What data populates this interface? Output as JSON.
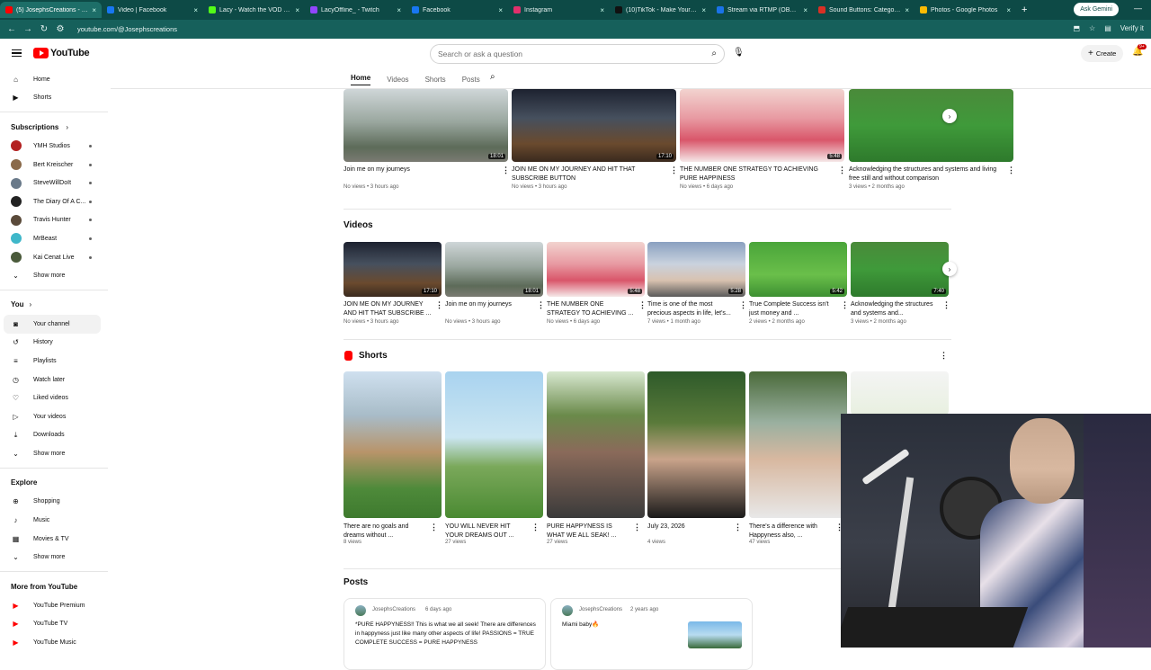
{
  "browser": {
    "tabs": [
      {
        "label": "(5) JosephsCreations - YouTube",
        "color": "#ff0000"
      },
      {
        "label": "Video | Facebook",
        "color": "#1877f2"
      },
      {
        "label": "Lacy - Watch the VOD on Kick",
        "color": "#53fc18"
      },
      {
        "label": "LacyOffline_ - Twitch",
        "color": "#9146ff"
      },
      {
        "label": "Facebook",
        "color": "#1877f2"
      },
      {
        "label": "Instagram",
        "color": "#e1306c"
      },
      {
        "label": "(10)TikTok - Make Your Day",
        "color": "#111111"
      },
      {
        "label": "Stream via RTMP (OBS, Vmix)",
        "color": "#1a73e8"
      },
      {
        "label": "Sound Buttons: Category V",
        "color": "#d93025"
      },
      {
        "label": "Photos - Google Photos",
        "color": "#fbbc04"
      }
    ],
    "ask_gemini": "Ask Gemini",
    "url": "youtube.com/@Josephscreations",
    "verify": "Verify it"
  },
  "header": {
    "logo_text": "YouTube",
    "search_placeholder": "Search or ask a question",
    "create_label": "Create",
    "notif_count": "9+"
  },
  "sidebar": {
    "main": [
      {
        "label": "Home",
        "icon": "home-icon",
        "glyph": "⌂"
      },
      {
        "label": "Shorts",
        "icon": "shorts-icon",
        "glyph": "▶"
      }
    ],
    "subscriptions_title": "Subscriptions",
    "subscriptions": [
      {
        "label": "YMH Studios",
        "color": "#b32020"
      },
      {
        "label": "Bert Kreischer",
        "color": "#8a6a4a"
      },
      {
        "label": "SteveWillDoIt",
        "color": "#6a7a8a"
      },
      {
        "label": "The Diary Of A C...",
        "color": "#222222"
      },
      {
        "label": "Travis Hunter",
        "color": "#5a4a3a"
      },
      {
        "label": "MrBeast",
        "color": "#3fb7c9"
      },
      {
        "label": "Kai Cenat Live",
        "color": "#4a5a3a"
      }
    ],
    "show_more": "Show more",
    "you_title": "You",
    "you_items": [
      {
        "label": "Your channel",
        "glyph": "◙"
      },
      {
        "label": "History",
        "glyph": "↺"
      },
      {
        "label": "Playlists",
        "glyph": "≡"
      },
      {
        "label": "Watch later",
        "glyph": "◷"
      },
      {
        "label": "Liked videos",
        "glyph": "♡"
      },
      {
        "label": "Your videos",
        "glyph": "▷"
      },
      {
        "label": "Downloads",
        "glyph": "⤓"
      }
    ],
    "explore_title": "Explore",
    "explore_items": [
      {
        "label": "Shopping",
        "glyph": "⊕"
      },
      {
        "label": "Music",
        "glyph": "♪"
      },
      {
        "label": "Movies & TV",
        "glyph": "▦"
      }
    ],
    "more_title": "More from YouTube",
    "more_items": [
      {
        "label": "YouTube Premium"
      },
      {
        "label": "YouTube TV"
      },
      {
        "label": "YouTube Music"
      }
    ]
  },
  "channel_tabs": [
    "Home",
    "Videos",
    "Shorts",
    "Posts"
  ],
  "top_row": [
    {
      "title": "Join me on my journeys",
      "meta": "No views • 3 hours ago",
      "duration": "18:01",
      "thumb": "linear-gradient(180deg,#cfd6d8 0%,#9aa79f 45%,#5d6b59 80%,#7a7a72 100%)"
    },
    {
      "title": "JOIN ME ON MY JOURNEY AND HIT THAT SUBSCRIBE BUTTON",
      "meta": "No views • 3 hours ago",
      "duration": "17:10",
      "thumb": "linear-gradient(180deg,#1d2230 0%,#46505e 40%,#6a4a2e 75%,#3a2a1e 100%)"
    },
    {
      "title": "THE NUMBER ONE STRATEGY TO ACHIEVING PURE HAPPINESS",
      "meta": "No views • 6 days ago",
      "duration": "5:48",
      "thumb": "linear-gradient(180deg,#f2d3cf 0%,#e89aa2 40%,#d9566a 70%,#f5e8e8 100%)"
    },
    {
      "title": "Acknowledging the structures and systems and living free still and without comparison",
      "meta": "3 views • 2 months ago",
      "duration": "",
      "thumb": "linear-gradient(180deg,#4a8a3a 0%,#3f9a3a 50%,#2e7a2c 100%)"
    }
  ],
  "videos_title": "Videos",
  "videos": [
    {
      "title": "JOIN ME ON MY JOURNEY AND HIT THAT SUBSCRIBE ...",
      "meta": "No views • 3 hours ago",
      "duration": "17:10",
      "thumb": "linear-gradient(180deg,#1d2230 0%,#46505e 40%,#6a4a2e 75%,#3a2a1e 100%)"
    },
    {
      "title": "Join me on my journeys",
      "meta": "No views • 3 hours ago",
      "duration": "18:01",
      "thumb": "linear-gradient(180deg,#cfd6d8 0%,#9aa79f 45%,#5d6b59 80%,#7a7a72 100%)"
    },
    {
      "title": "THE NUMBER ONE STRATEGY TO ACHIEVING ...",
      "meta": "No views • 6 days ago",
      "duration": "5:48",
      "thumb": "linear-gradient(180deg,#f2d3cf 0%,#e89aa2 40%,#d9566a 70%,#f5e8e8 100%)"
    },
    {
      "title": "Time is one of the most precious aspects in life, let's...",
      "meta": "7 views • 1 month ago",
      "duration": "5:28",
      "thumb": "linear-gradient(180deg,#8aa0c0 0%,#c9d2de 40%,#d8c2b0 70%,#5a5a5a 100%)"
    },
    {
      "title": "True Complete Success isn't just money and ...",
      "meta": "2 views • 2 months ago",
      "duration": "5:42",
      "thumb": "linear-gradient(180deg,#4aa53a 0%,#6abf4a 60%,#3d8f32 100%)"
    },
    {
      "title": "Acknowledging the structures and systems and...",
      "meta": "3 views • 2 months ago",
      "duration": "7:40",
      "thumb": "linear-gradient(180deg,#4a8a3a 0%,#3f9a3a 50%,#2e7a2c 100%)"
    }
  ],
  "shorts_title": "Shorts",
  "shorts": [
    {
      "title": "There are no goals and dreams without ...",
      "meta": "8 views",
      "thumb": "linear-gradient(180deg,#cfe0ef 0%,#a8bcc8 30%,#b8946a 55%,#4e8a3a 80%,#3e7a2e 100%)"
    },
    {
      "title": "YOU WILL NEVER HIT YOUR DREAMS OUT ...",
      "meta": "27 views",
      "thumb": "linear-gradient(180deg,#a9d3ef 0%,#cbe6f2 45%,#7aa85a 65%,#4a8a32 100%)"
    },
    {
      "title": "PURE HAPPYNESS IS WHAT WE ALL SEAK! ...",
      "meta": "27 views",
      "thumb": "linear-gradient(180deg,#d8e8d0 0%,#6a8a4a 30%,#8a6a5a 55%,#3a3a3a 100%)"
    },
    {
      "title": "July 23, 2026",
      "meta": "4 views",
      "thumb": "linear-gradient(180deg,#2e5a2a 0%,#5a7a3a 35%,#c9a38a 60%,#1a1a1a 100%)"
    },
    {
      "title": "There's a difference with Happyness also, ...",
      "meta": "47 views",
      "thumb": "linear-gradient(180deg,#4a6a3a 0%,#9ab0a0 35%,#d8b8a0 60%,#e8e8e8 100%)"
    }
  ],
  "posts_title": "Posts",
  "posts": [
    {
      "author": "JosephsCreations",
      "age": "6 days ago",
      "text": "*PURE HAPPYNESS!! This is what we all seek! There are differences in happyness just like many other aspects of life! PASSIONS = TRUE COMPLETE SUCCESS = PURE HAPPYNESS"
    },
    {
      "author": "JosephsCreations",
      "age": "2 years ago",
      "text": "Miami baby🔥"
    }
  ]
}
